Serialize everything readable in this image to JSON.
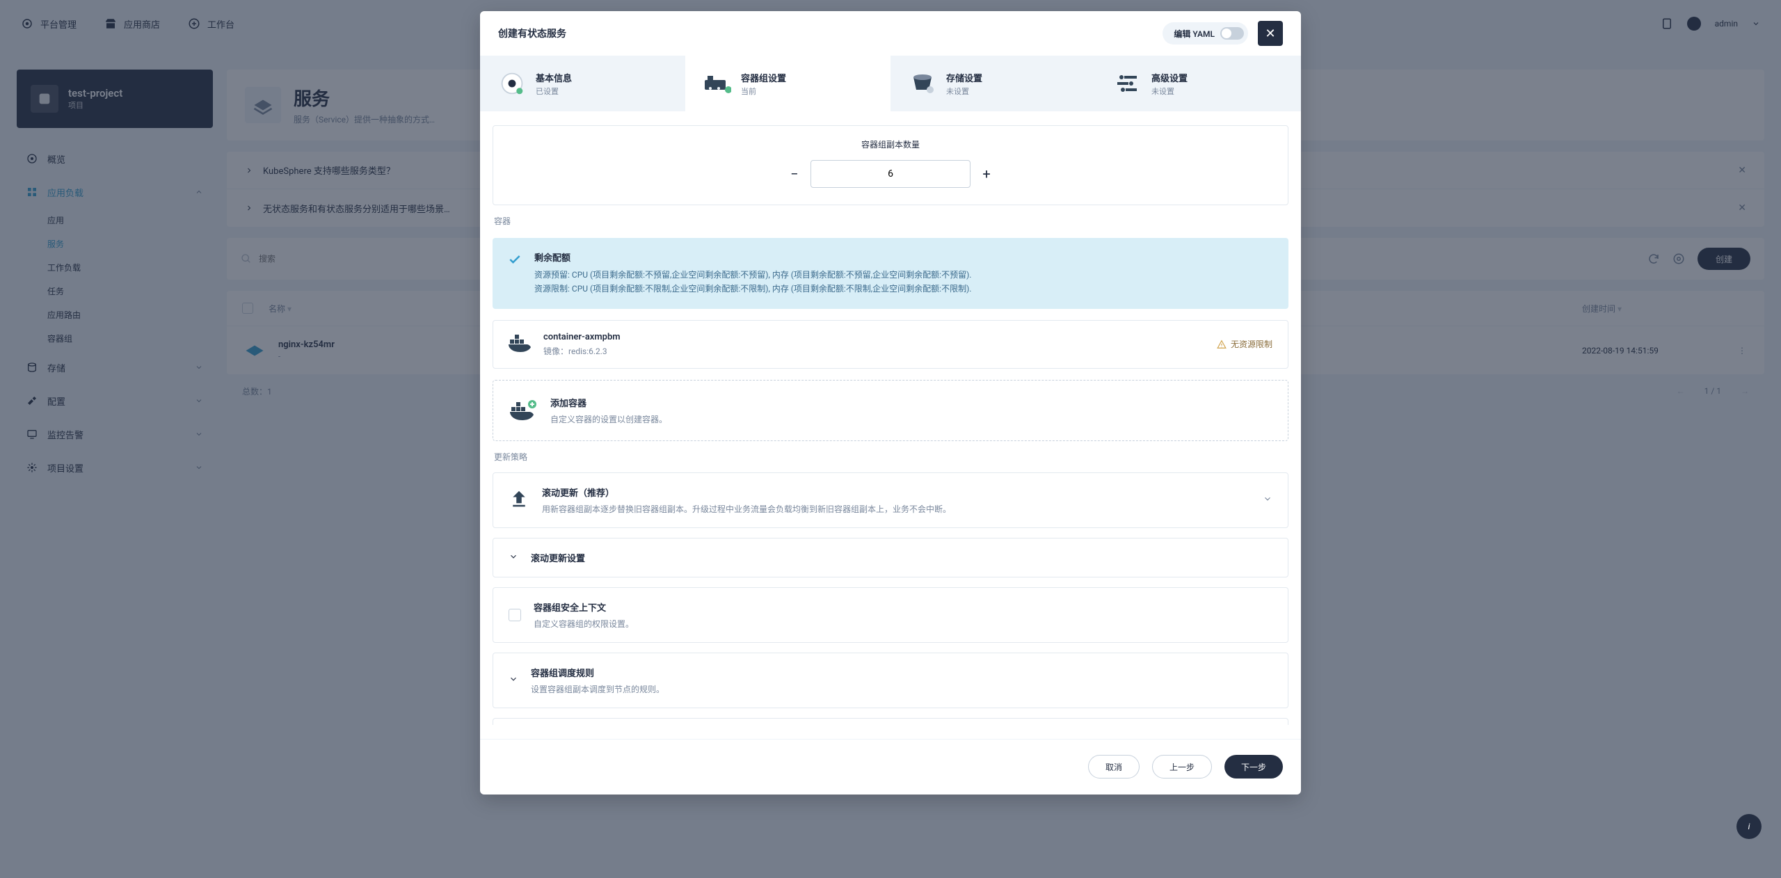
{
  "topnav": {
    "platform": "平台管理",
    "appstore": "应用商店",
    "workbench": "工作台",
    "user": "admin"
  },
  "project": {
    "name": "test-project",
    "sub": "项目"
  },
  "sidebar": {
    "overview": "概览",
    "workloads": "应用负载",
    "workloads_items": {
      "apps": "应用",
      "services": "服务",
      "workload": "工作负载",
      "jobs": "任务",
      "routes": "应用路由",
      "pods": "容器组"
    },
    "storage": "存储",
    "config": "配置",
    "monitoring": "监控告警",
    "projectsettings": "项目设置"
  },
  "page": {
    "title": "服务",
    "desc": "服务（Service）提供一种抽象的方式…",
    "faq1": "KubeSphere 支持哪些服务类型？",
    "faq2": "无状态服务和有状态服务分别适用于哪些场景…"
  },
  "toolbar": {
    "search_placeholder": "搜索",
    "create": "创建"
  },
  "table": {
    "col_name": "名称",
    "col_time": "创建时间",
    "rows": [
      {
        "name": "nginx-kz54mr",
        "sub": "-",
        "time": "2022-08-19 14:51:59"
      }
    ],
    "total_label": "总数：1",
    "page_label": "1 / 1"
  },
  "modal": {
    "title": "创建有状态服务",
    "edit_yaml": "编辑 YAML",
    "steps": {
      "basic": {
        "title": "基本信息",
        "status": "已设置"
      },
      "pod": {
        "title": "容器组设置",
        "status": "当前"
      },
      "store": {
        "title": "存储设置",
        "status": "未设置"
      },
      "adv": {
        "title": "高级设置",
        "status": "未设置"
      }
    },
    "replica": {
      "title": "容器组副本数量",
      "value": "6"
    },
    "container_section": "容器",
    "quota": {
      "title": "剩余配额",
      "line1": "资源预留: CPU (项目剩余配额:不预留,企业空间剩余配额:不预留),   内存 (项目剩余配额:不预留,企业空间剩余配额:不预留).",
      "line2": "资源限制: CPU (项目剩余配额:不限制,企业空间剩余配额:不限制),   内存 (项目剩余配额:不限制,企业空间剩余配额:不限制)."
    },
    "container": {
      "name": "container-axmpbm",
      "image": "镜像：redis:6.2.3",
      "warn": "无资源限制"
    },
    "add_container": {
      "title": "添加容器",
      "desc": "自定义容器的设置以创建容器。"
    },
    "update_section": "更新策略",
    "rolling": {
      "title": "滚动更新（推荐）",
      "desc": "用新容器组副本逐步替换旧容器组副本。升级过程中业务流量会负载均衡到新旧容器组副本上，业务不会中断。"
    },
    "rolling_settings": "滚动更新设置",
    "security": {
      "title": "容器组安全上下文",
      "desc": "自定义容器组的权限设置。"
    },
    "scheduling": {
      "title": "容器组调度规则",
      "desc": "设置容器组副本调度到节点的规则。"
    },
    "footer": {
      "cancel": "取消",
      "prev": "上一步",
      "next": "下一步"
    }
  }
}
